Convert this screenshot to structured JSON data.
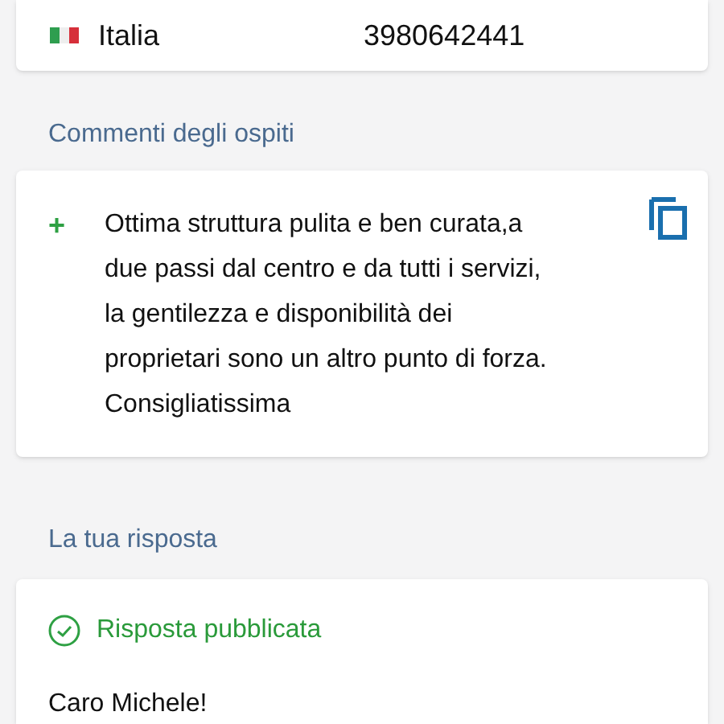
{
  "contact": {
    "country": "Italia",
    "phone": "3980642441"
  },
  "comments": {
    "heading": "Commenti degli ospiti",
    "items": [
      {
        "kind": "positive",
        "sign": "+",
        "text": "Ottima struttura pulita e ben curata,a\ndue passi dal centro e da tutti i servizi,\nla gentilezza e disponibilità dei\nproprietari sono un altro punto di forza.\nConsigliatissima"
      }
    ]
  },
  "reply": {
    "heading": "La tua risposta",
    "status": {
      "published": true,
      "label": "Risposta pubblicata"
    },
    "greeting": "Caro Michele!"
  }
}
